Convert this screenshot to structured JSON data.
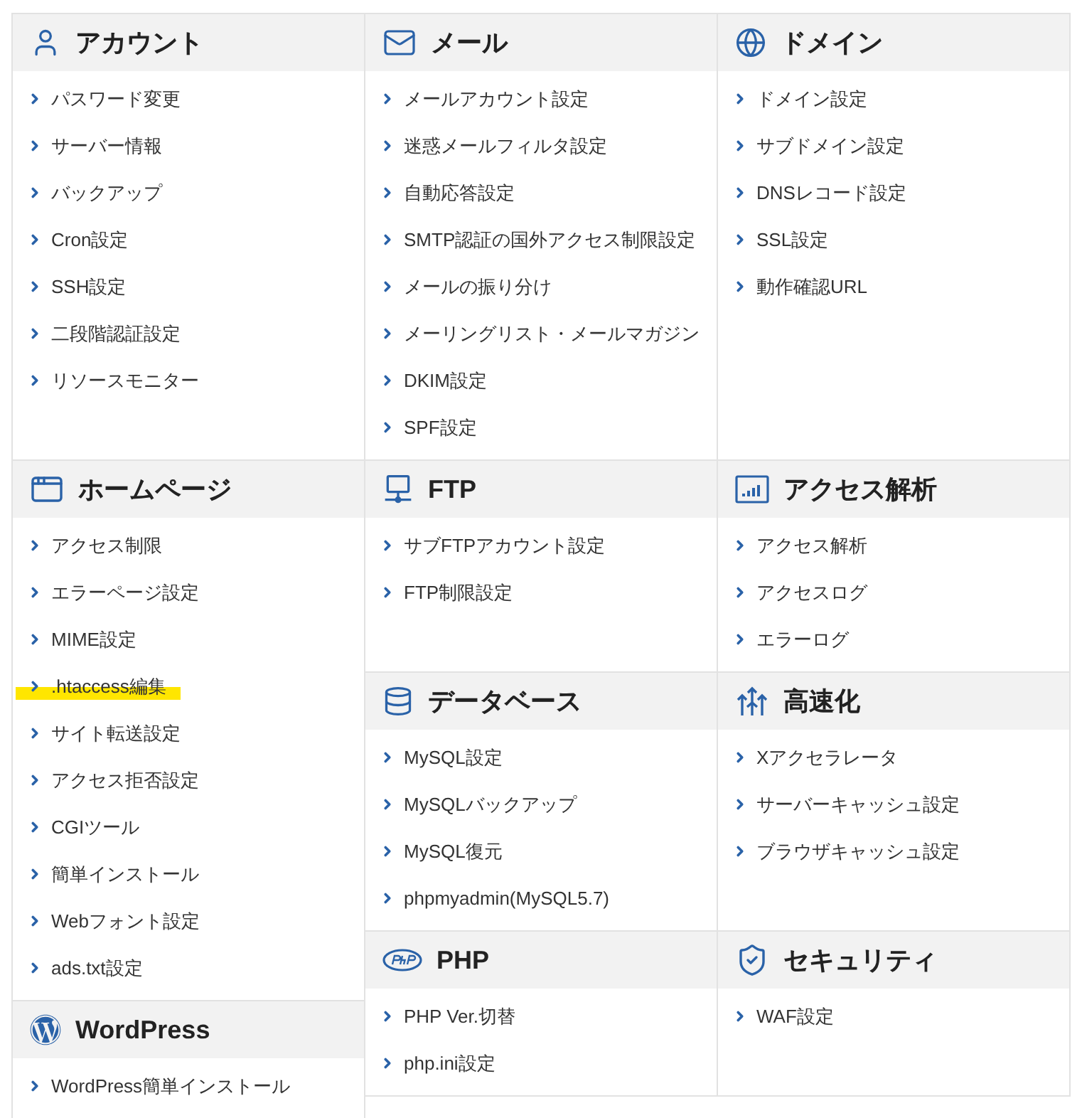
{
  "top_row": [
    {
      "title": "アカウント",
      "items": [
        {
          "label": "パスワード変更"
        },
        {
          "label": "サーバー情報"
        },
        {
          "label": "バックアップ"
        },
        {
          "label": "Cron設定"
        },
        {
          "label": "SSH設定"
        },
        {
          "label": "二段階認証設定"
        },
        {
          "label": "リソースモニター"
        }
      ]
    },
    {
      "title": "メール",
      "items": [
        {
          "label": "メールアカウント設定"
        },
        {
          "label": "迷惑メールフィルタ設定"
        },
        {
          "label": "自動応答設定"
        },
        {
          "label": "SMTP認証の国外アクセス制限設定"
        },
        {
          "label": "メールの振り分け"
        },
        {
          "label": "メーリングリスト・メールマガジン"
        },
        {
          "label": "DKIM設定"
        },
        {
          "label": "SPF設定"
        }
      ]
    },
    {
      "title": "ドメイン",
      "items": [
        {
          "label": "ドメイン設定"
        },
        {
          "label": "サブドメイン設定"
        },
        {
          "label": "DNSレコード設定"
        },
        {
          "label": "SSL設定"
        },
        {
          "label": "動作確認URL"
        }
      ]
    }
  ],
  "left_column": [
    {
      "title": "ホームページ",
      "items": [
        {
          "label": "アクセス制限"
        },
        {
          "label": "エラーページ設定"
        },
        {
          "label": "MIME設定"
        },
        {
          "label": ".htaccess編集",
          "highlighted": true
        },
        {
          "label": "サイト転送設定"
        },
        {
          "label": "アクセス拒否設定"
        },
        {
          "label": "CGIツール"
        },
        {
          "label": "簡単インストール"
        },
        {
          "label": "Webフォント設定"
        },
        {
          "label": "ads.txt設定"
        }
      ]
    },
    {
      "title": "WordPress",
      "items": [
        {
          "label": "WordPress簡単インストール"
        }
      ]
    }
  ],
  "right_grid": [
    {
      "title": "FTP",
      "items": [
        {
          "label": "サブFTPアカウント設定"
        },
        {
          "label": "FTP制限設定"
        }
      ]
    },
    {
      "title": "アクセス解析",
      "items": [
        {
          "label": "アクセス解析"
        },
        {
          "label": "アクセスログ"
        },
        {
          "label": "エラーログ"
        }
      ]
    },
    {
      "title": "データベース",
      "items": [
        {
          "label": "MySQL設定"
        },
        {
          "label": "MySQLバックアップ"
        },
        {
          "label": "MySQL復元"
        },
        {
          "label": "phpmyadmin(MySQL5.7)"
        }
      ]
    },
    {
      "title": "高速化",
      "items": [
        {
          "label": "Xアクセラレータ"
        },
        {
          "label": "サーバーキャッシュ設定"
        },
        {
          "label": "ブラウザキャッシュ設定"
        }
      ]
    },
    {
      "title": "PHP",
      "items": [
        {
          "label": "PHP Ver.切替"
        },
        {
          "label": "php.ini設定"
        }
      ]
    },
    {
      "title": "セキュリティ",
      "items": [
        {
          "label": "WAF設定"
        }
      ]
    }
  ]
}
